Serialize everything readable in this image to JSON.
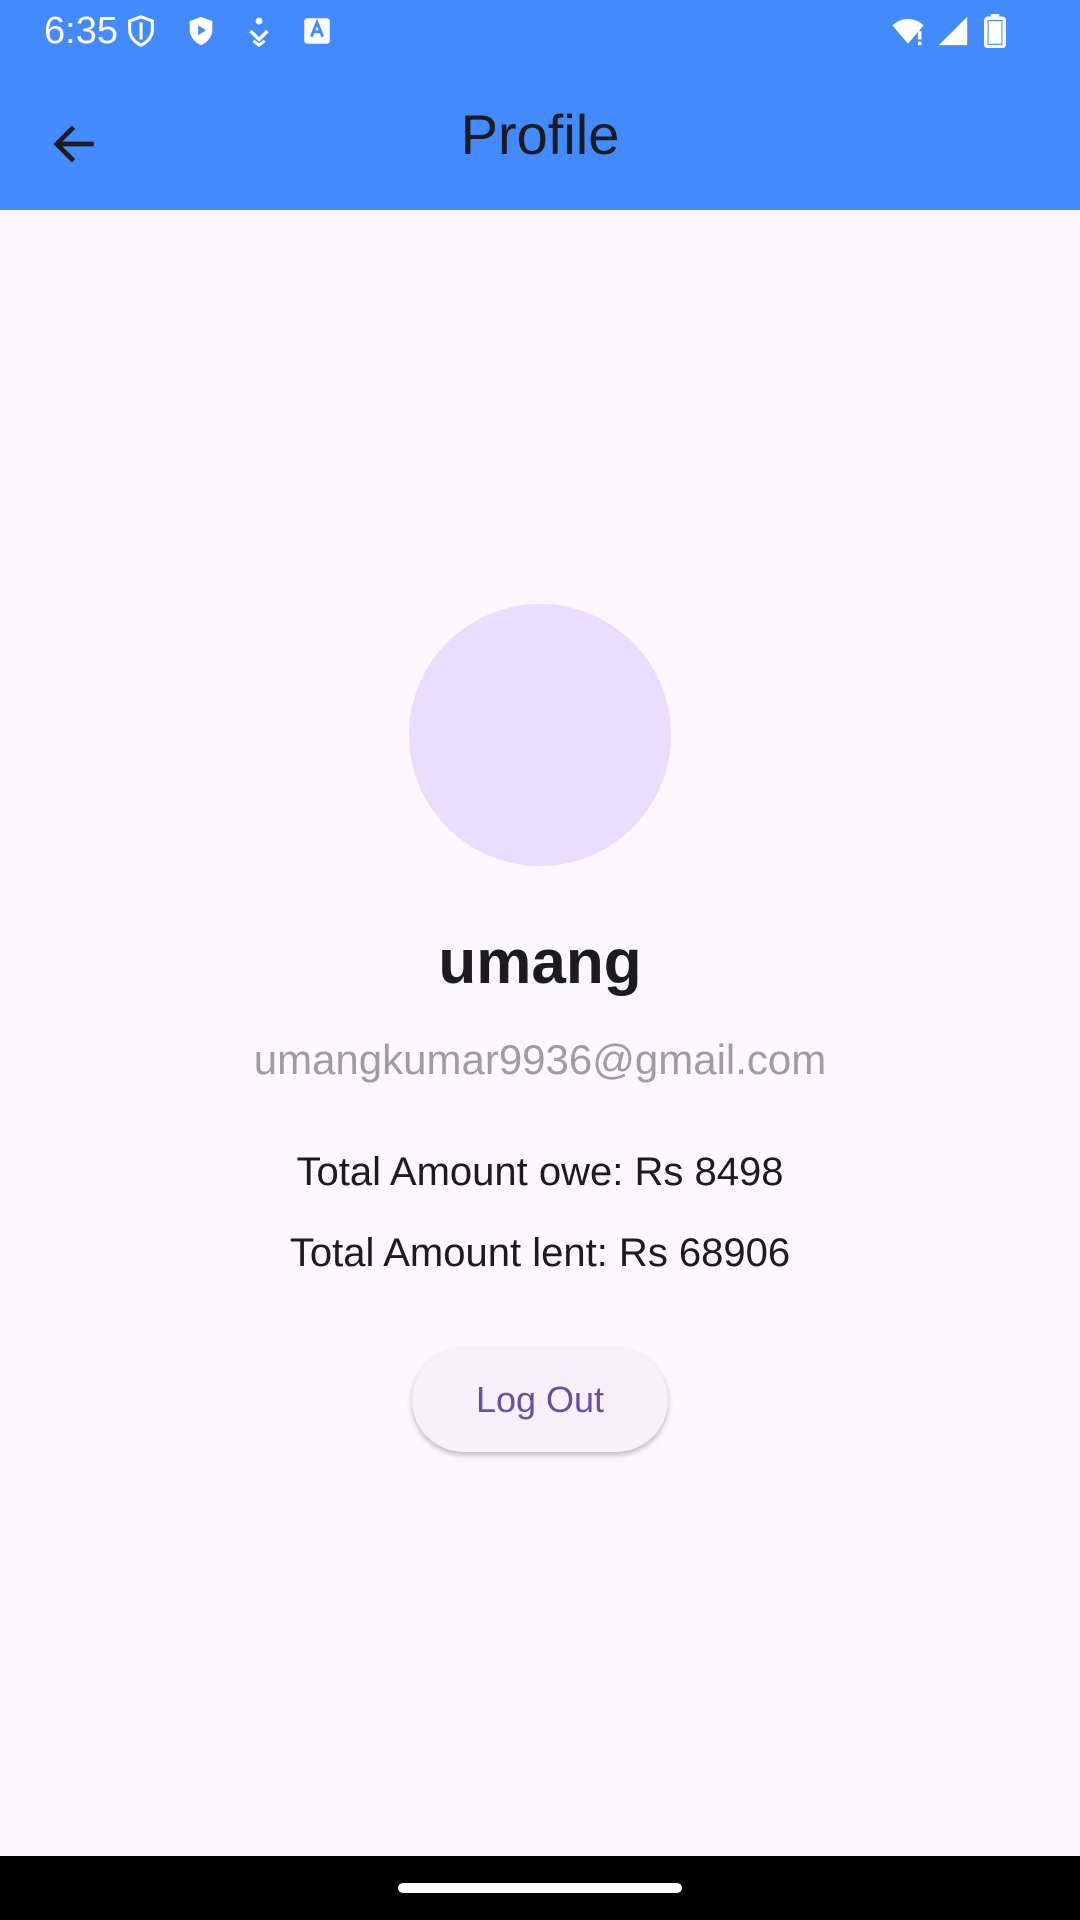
{
  "status_bar": {
    "time": "6:35",
    "icons": [
      "vpn-shield-icon",
      "play-protect-icon",
      "accessibility-icon",
      "text-icon",
      "wifi-icon",
      "signal-icon",
      "battery-icon"
    ]
  },
  "app_bar": {
    "title": "Profile",
    "back_icon": "arrow-back-icon",
    "color": "#448AFF"
  },
  "profile": {
    "avatar_color": "#EADDFF",
    "name": "umang",
    "email": "umangkumar9936@gmail.com",
    "total_owe": "Total Amount owe: Rs 8498",
    "total_lent": "Total Amount lent: Rs 68906"
  },
  "actions": {
    "logout_label": "Log Out",
    "accent_color": "#6750A4"
  },
  "theme": {
    "background": "#FDF7FE"
  }
}
